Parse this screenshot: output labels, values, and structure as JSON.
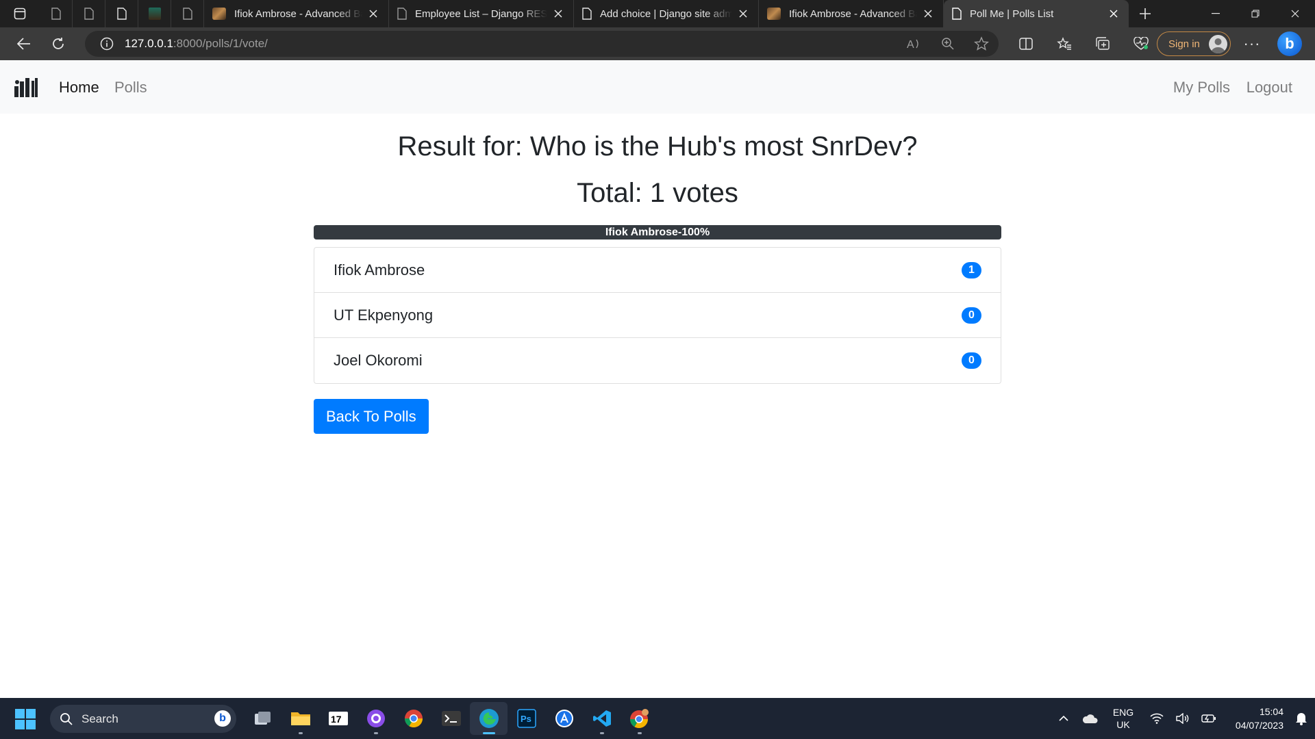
{
  "browser": {
    "tabs": [
      {
        "title": "Ifiok Ambrose - Advanced Ba",
        "icon": "image-favicon"
      },
      {
        "title": "Employee List – Django REST",
        "icon": "page-icon"
      },
      {
        "title": "Add choice | Django site adm",
        "icon": "page-icon"
      },
      {
        "title": "Ifiok Ambrose - Advanced Ba",
        "icon": "image-favicon"
      },
      {
        "title": "Poll Me | Polls List",
        "icon": "page-icon",
        "active": true
      }
    ],
    "url_host": "127.0.0.1",
    "url_path": ":8000/polls/1/vote/",
    "sign_in_label": "Sign in"
  },
  "navbar": {
    "home_label": "Home",
    "polls_label": "Polls",
    "my_polls_label": "My Polls",
    "logout_label": "Logout"
  },
  "result": {
    "title": "Result for: Who is the Hub's most SnrDev?",
    "total": "Total: 1 votes",
    "progress_label": "Ifiok Ambrose-100%",
    "progress_fraction": 1.0,
    "choices": [
      {
        "name": "Ifiok Ambrose",
        "votes": "1"
      },
      {
        "name": "UT Ekpenyong",
        "votes": "0"
      },
      {
        "name": "Joel Okoromi",
        "votes": "0"
      }
    ],
    "back_button_label": "Back To Polls"
  },
  "taskbar": {
    "search_label": "Search",
    "lang_line1": "ENG",
    "lang_line2": "UK",
    "time": "15:04",
    "date": "04/07/2023"
  },
  "colors": {
    "primary": "#007bff",
    "progress_bar": "#343a40",
    "navbar_bg": "#f8f9fa",
    "browser_chrome": "#202020",
    "taskbar_bg": "#1c2433"
  }
}
